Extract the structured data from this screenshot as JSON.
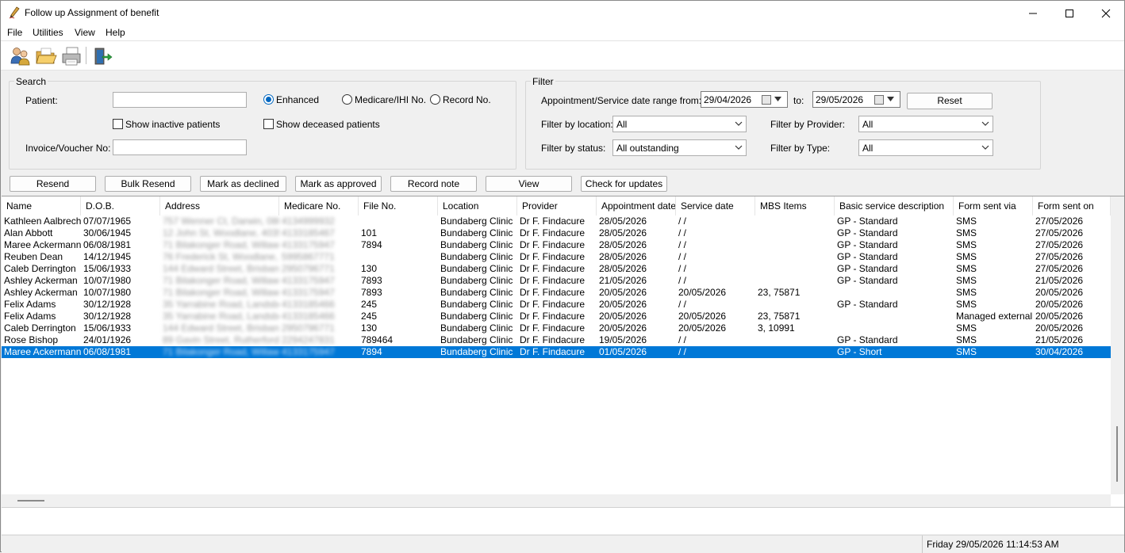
{
  "window": {
    "title": "Follow up Assignment of benefit"
  },
  "menu": {
    "items": [
      "File",
      "Utilities",
      "View",
      "Help"
    ]
  },
  "toolbar": {
    "icons": [
      "patients-icon",
      "open-folder-icon",
      "print-icon",
      "exit-icon"
    ]
  },
  "search": {
    "legend": "Search",
    "patient_label": "Patient:",
    "patient_value": "",
    "radio_enhanced": "Enhanced",
    "radio_medicare": "Medicare/IHI No.",
    "radio_record": "Record No.",
    "selected_radio": "Enhanced",
    "show_inactive": "Show inactive patients",
    "show_deceased": "Show deceased patients",
    "invoice_label": "Invoice/Voucher No:",
    "invoice_value": ""
  },
  "filter": {
    "legend": "Filter",
    "date_range_label": "Appointment/Service date range from:",
    "date_from": "29/04/2026",
    "to_label": "to:",
    "date_to": "29/05/2026",
    "reset": "Reset",
    "location_label": "Filter by location:",
    "location_value": "All",
    "provider_label": "Filter by Provider:",
    "provider_value": "All",
    "status_label": "Filter by status:",
    "status_value": "All outstanding",
    "type_label": "Filter by Type:",
    "type_value": "All"
  },
  "actions": {
    "resend": "Resend",
    "bulk_resend": "Bulk Resend",
    "mark_declined": "Mark as declined",
    "mark_approved": "Mark as approved",
    "record_note": "Record note",
    "view": "View",
    "check_updates": "Check for updates"
  },
  "table": {
    "columns": [
      "Name",
      "D.O.B.",
      "Address",
      "Medicare No.",
      "File No.",
      "Location",
      "Provider",
      "Appointment date",
      "Service date",
      "MBS Items",
      "Basic service description",
      "Form sent via",
      "Form sent on"
    ],
    "rows": [
      [
        "Kathleen Aalbrecht",
        "07/07/1965",
        "757 Wenner Ct, Darwin, 0800",
        "4134999932",
        "",
        "Bundaberg Clinic",
        "Dr F. Findacure",
        "28/05/2026",
        " / /",
        "",
        "GP - Standard",
        "SMS",
        "27/05/2026"
      ],
      [
        "Alan Abbott",
        "30/06/1945",
        "12 John St, Woodlane, 4035",
        "4133185467",
        "101",
        "Bundaberg Clinic",
        "Dr F. Findacure",
        "28/05/2026",
        " / /",
        "",
        "GP - Standard",
        "SMS",
        "27/05/2026"
      ],
      [
        "Maree Ackermann",
        "06/08/1981",
        "71 Bilakonger Road, Willawong",
        "4133175947",
        "7894",
        "Bundaberg Clinic",
        "Dr F. Findacure",
        "28/05/2026",
        " / /",
        "",
        "GP - Standard",
        "SMS",
        "27/05/2026"
      ],
      [
        "Reuben Dean",
        "14/12/1945",
        "76 Frederick St, Woodlane, 52",
        "5995867771",
        "",
        "Bundaberg Clinic",
        "Dr F. Findacure",
        "28/05/2026",
        " / /",
        "",
        "GP - Standard",
        "SMS",
        "27/05/2026"
      ],
      [
        "Caleb Derrington",
        "15/06/1933",
        "144 Edward Street, Brisbane, 4",
        "2950796771",
        "130",
        "Bundaberg Clinic",
        "Dr F. Findacure",
        "28/05/2026",
        " / /",
        "",
        "GP - Standard",
        "SMS",
        "27/05/2026"
      ],
      [
        "Ashley Ackerman",
        "10/07/1980",
        "71 Bilakonger Road, Willawong",
        "4133175947",
        "7893",
        "Bundaberg Clinic",
        "Dr F. Findacure",
        "21/05/2026",
        " / /",
        "",
        "GP - Standard",
        "SMS",
        "21/05/2026"
      ],
      [
        "Ashley Ackerman",
        "10/07/1980",
        "71 Bilakonger Road, Willawong",
        "4133175947",
        "7893",
        "Bundaberg Clinic",
        "Dr F. Findacure",
        "20/05/2026",
        "20/05/2026",
        "23, 75871",
        "",
        "SMS",
        "20/05/2026"
      ],
      [
        "Felix Adams",
        "30/12/1928",
        "35 Yarrabine Road, Landsborough",
        "4133185466",
        "245",
        "Bundaberg Clinic",
        "Dr F. Findacure",
        "20/05/2026",
        " / /",
        "",
        "GP - Standard",
        "SMS",
        "20/05/2026"
      ],
      [
        "Felix Adams",
        "30/12/1928",
        "35 Yarrabine Road, Landsborough",
        "4133185466",
        "245",
        "Bundaberg Clinic",
        "Dr F. Findacure",
        "20/05/2026",
        "20/05/2026",
        "23, 75871",
        "",
        "Managed externally",
        "20/05/2026"
      ],
      [
        "Caleb Derrington",
        "15/06/1933",
        "144 Edward Street, Brisbane, 4",
        "2950796771",
        "130",
        "Bundaberg Clinic",
        "Dr F. Findacure",
        "20/05/2026",
        "20/05/2026",
        "3, 10991",
        "",
        "SMS",
        "20/05/2026"
      ],
      [
        "Rose Bishop",
        "24/01/1926",
        "89 Gavin Street, Rutherford, 23",
        "2294247831",
        "789464",
        "Bundaberg Clinic",
        "Dr F. Findacure",
        "19/05/2026",
        " / /",
        "",
        "GP - Standard",
        "SMS",
        "21/05/2026"
      ],
      [
        "Maree Ackermann",
        "06/08/1981",
        "71 Bilakonger Road, Willawong",
        "4133175947",
        "7894",
        "Bundaberg Clinic",
        "Dr F. Findacure",
        "01/05/2026",
        " / /",
        "",
        "GP - Short",
        "SMS",
        "30/04/2026"
      ]
    ],
    "selected_row": 11
  },
  "status": {
    "datetime": "Friday 29/05/2026 11:14:53 AM"
  },
  "colors": {
    "selection": "#0078d7",
    "accent": "#0067c0"
  }
}
